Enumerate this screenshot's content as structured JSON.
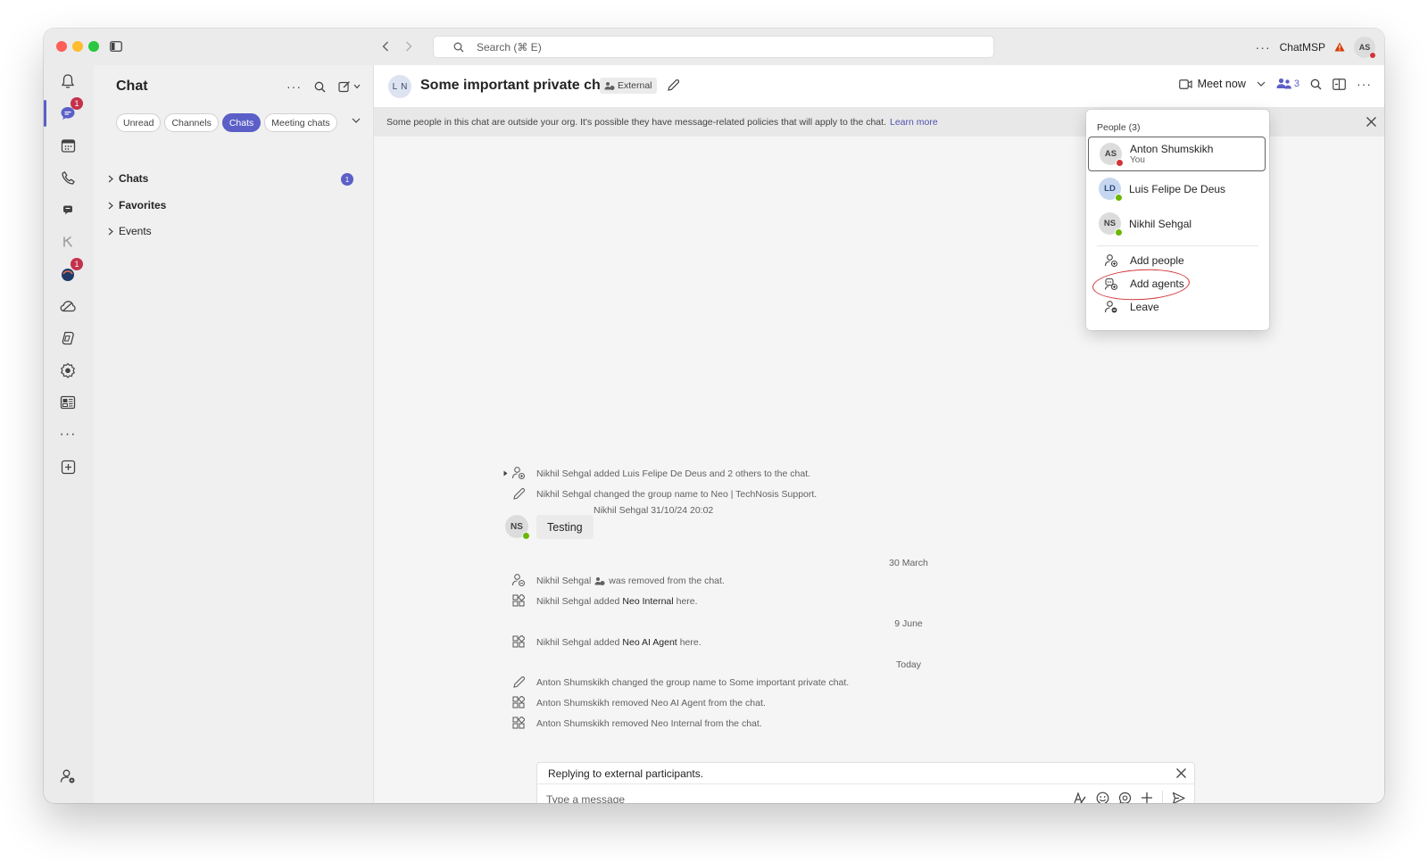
{
  "titlebar": {
    "search_placeholder": "Search (⌘ E)",
    "org_name": "ChatMSP",
    "user_initials": "AS"
  },
  "rail": {
    "chat_badge": "1",
    "app_badge": "1"
  },
  "chat_list": {
    "title": "Chat",
    "filters": [
      "Unread",
      "Channels",
      "Chats",
      "Meeting chats"
    ],
    "active_filter": "Chats",
    "sections": [
      {
        "label": "Chats",
        "badge": "1"
      },
      {
        "label": "Favorites"
      },
      {
        "label": "Events"
      }
    ]
  },
  "header": {
    "group_initials": [
      "L",
      "N"
    ],
    "title": "Some important private chat",
    "external_tag": "External",
    "meet_now": "Meet now",
    "people_count": "3"
  },
  "banner": {
    "text": "Some people in this chat are outside your org. It's possible they have message-related policies that will apply to the chat.",
    "link": "Learn more"
  },
  "messages": {
    "event1": "Nikhil Sehgal added Luis Felipe De Deus and 2 others to the chat.",
    "event2": "Nikhil Sehgal changed the group name to Neo | TechNosis Support.",
    "author": "Nikhil Sehgal  31/10/24 20:02",
    "author_initials": "NS",
    "bubble": "Testing",
    "date1": "30 March",
    "event3_pre": "Nikhil Sehgal",
    "event3_post": "was removed from the chat.",
    "event4_pre": "Nikhil Sehgal added",
    "event4_bold": "Neo Internal",
    "event4_post": "here.",
    "date2": "9 June",
    "event5_pre": "Nikhil Sehgal added",
    "event5_bold": "Neo AI Agent",
    "event5_post": "here.",
    "date3": "Today",
    "event6": "Anton Shumskikh changed the group name to Some important private chat.",
    "event7": "Anton Shumskikh removed Neo AI Agent from the chat.",
    "event8": "Anton Shumskikh removed Neo Internal from the chat."
  },
  "compose": {
    "reply_notice": "Replying to external participants.",
    "placeholder": "Type a message"
  },
  "people_popup": {
    "heading": "People (3)",
    "people": [
      {
        "initials": "AS",
        "name": "Anton Shumskikh",
        "sub": "You",
        "status_color": "#d13438"
      },
      {
        "initials": "LD",
        "name": "Luis Felipe De Deus",
        "status_color": "#6bb700"
      },
      {
        "initials": "NS",
        "name": "Nikhil Sehgal",
        "status_color": "#6bb700"
      }
    ],
    "actions": [
      "Add people",
      "Add agents",
      "Leave"
    ]
  },
  "colors": {
    "accent": "#5b5fc7",
    "badge": "#c4314b",
    "annotation": "#d13438"
  }
}
